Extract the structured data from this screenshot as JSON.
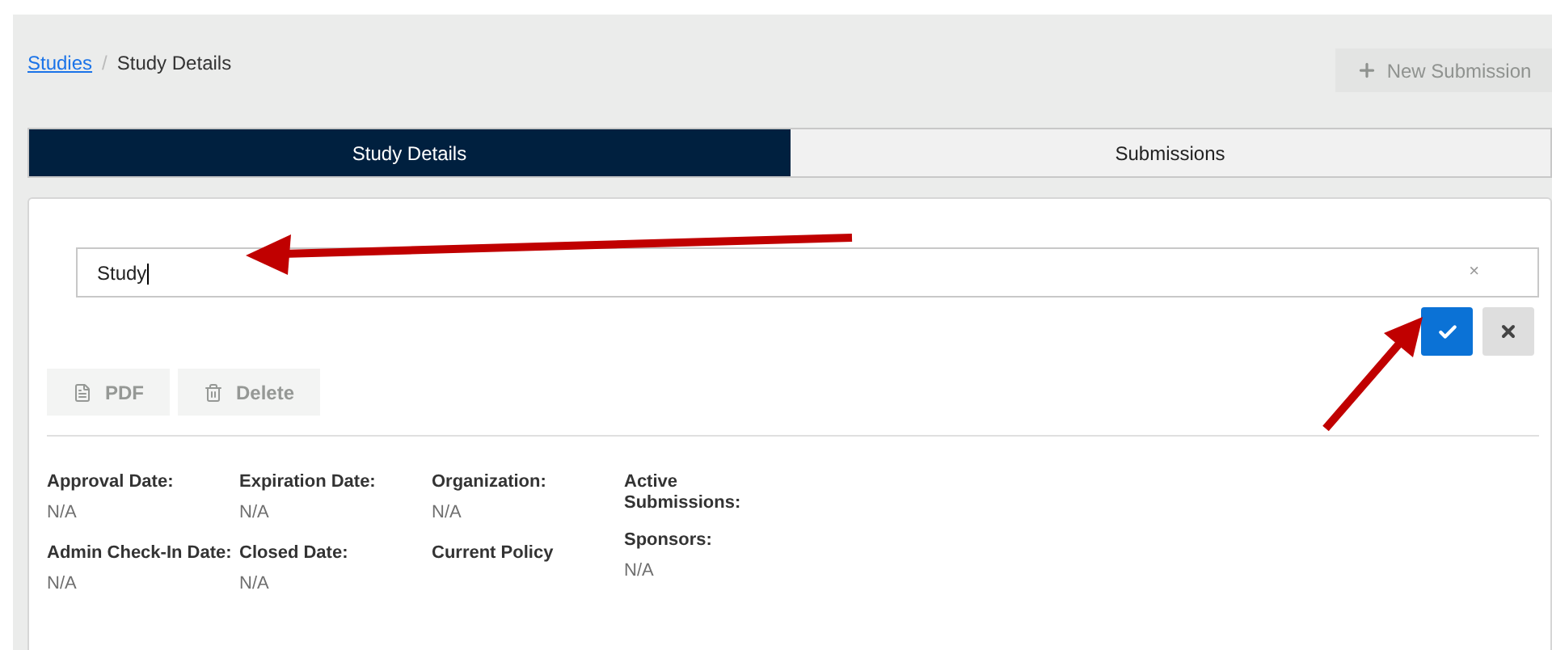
{
  "breadcrumb": {
    "link": "Studies",
    "separator": "/",
    "current": "Study Details"
  },
  "new_submission": {
    "label": "New Submission",
    "disabled": true
  },
  "tabs": [
    {
      "label": "Study Details",
      "selected": true
    },
    {
      "label": "Submissions",
      "selected": false
    }
  ],
  "title_field": {
    "value": "Study",
    "clear": "×"
  },
  "actions": [
    {
      "label": "PDF",
      "kind": "pdf",
      "disabled": true
    },
    {
      "label": "Delete",
      "kind": "delete",
      "disabled": true
    }
  ],
  "columns": [
    [
      {
        "label": "Approval Date:",
        "value": "N/A"
      },
      {
        "label": "Admin Check-In Date:",
        "value": "N/A"
      }
    ],
    [
      {
        "label": "Expiration Date:",
        "value": "N/A"
      },
      {
        "label": "Closed Date:",
        "value": "N/A"
      }
    ],
    [
      {
        "label": "Organization:",
        "value": "N/A"
      },
      {
        "label": "Current Policy"
      }
    ],
    [
      {
        "label": "Active Submissions:"
      },
      {
        "label": "Sponsors:",
        "value": "N/A"
      }
    ]
  ]
}
